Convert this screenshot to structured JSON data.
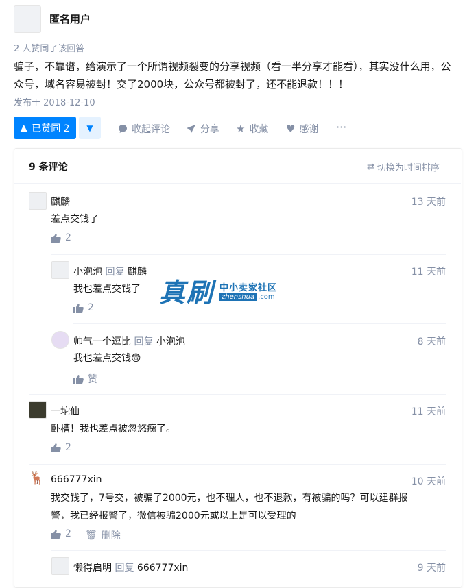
{
  "author": {
    "name": "匿名用户"
  },
  "answer": {
    "likes_line": "2 人赞同了该回答",
    "text": "骗子，不靠谱，给演示了一个所谓视频裂变的分享视频（看一半分享才能看），其实没什么用，公众号，域名容易被封！交了2000块，公众号都被封了，还不能退款！！！",
    "date": "发布于 2018-12-10"
  },
  "actions": {
    "vote_label": "已赞同 2",
    "collapse": "收起评论",
    "share": "分享",
    "collect": "收藏",
    "thanks": "感谢",
    "more": "···"
  },
  "comments_header": {
    "count": "9 条评论",
    "sort": "切换为时间排序"
  },
  "watermark": {
    "big": "真刷",
    "cn": "中小卖家社区",
    "domain": "zhenshua",
    "tld": ".com"
  },
  "comments": [
    {
      "name": "麒麟",
      "reply_word": "",
      "reply_to": "",
      "time": "13 天前",
      "text": "差点交钱了",
      "likes": "2",
      "delete": ""
    },
    {
      "name": "小泡泡",
      "reply_word": "回复",
      "reply_to": "麒麟",
      "time": "11 天前",
      "text": "我也差点交钱了",
      "likes": "2",
      "delete": ""
    },
    {
      "name": "帅气一个逗比",
      "reply_word": "回复",
      "reply_to": "小泡泡",
      "time": "8 天前",
      "text": "我也差点交钱😨",
      "likes": "赞",
      "delete": ""
    },
    {
      "name": "一坨仙",
      "reply_word": "",
      "reply_to": "",
      "time": "11 天前",
      "text": "卧槽！我也差点被忽悠瘸了。",
      "likes": "2",
      "delete": ""
    },
    {
      "name": "666777xin",
      "reply_word": "",
      "reply_to": "",
      "time": "10 天前",
      "text1": "我交钱了，7号交，被骗了2000元，也不理人，也不退款，有被骗的吗？可以建群报",
      "text2": "警，我已经报警了，微信被骗2000元或以上是可以受理的",
      "likes": "2",
      "delete": "删除"
    },
    {
      "name": "懒得启明",
      "reply_word": "回复",
      "reply_to": "666777xin",
      "time": "9 天前"
    }
  ]
}
